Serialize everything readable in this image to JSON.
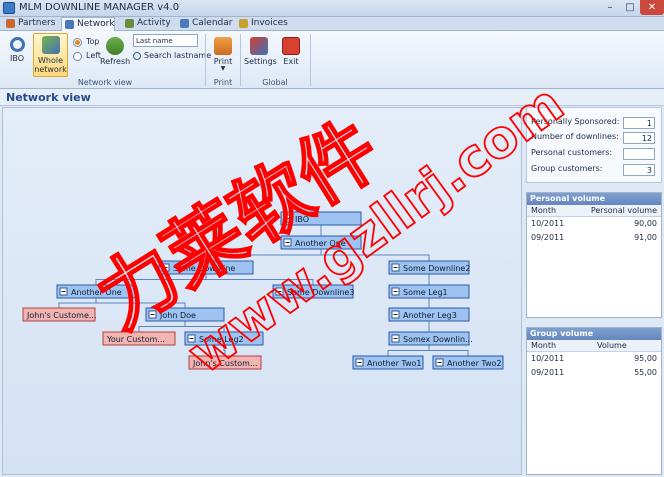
{
  "window": {
    "title": "MLM DOWNLINE MANAGER v4.0"
  },
  "tabs": [
    {
      "label": "Partners",
      "icon": "partners-icon",
      "color": "#c9672e",
      "active": false
    },
    {
      "label": "Network",
      "icon": "network-icon",
      "color": "#4a78b8",
      "active": true
    },
    {
      "label": "Activity",
      "icon": "activity-icon",
      "color": "#6a8f3a",
      "active": false
    },
    {
      "label": "Calendar",
      "icon": "calendar-icon",
      "color": "#4a78b8",
      "active": false
    },
    {
      "label": "Invoices",
      "icon": "invoices-icon",
      "color": "#c9a12e",
      "active": false
    }
  ],
  "ribbon": {
    "ibo_label": "IBO",
    "whole_network_label": "Whole\nnetwork",
    "top_label": "Top",
    "left_label": "Left",
    "refresh_label": "Refresh",
    "search_value": "Last name",
    "search_lastname_label": "Search lastname",
    "network_view_group": "Network view",
    "print_label": "Print",
    "print_group": "Print",
    "settings_label": "Settings",
    "exit_label": "Exit",
    "global_group": "Global"
  },
  "view": {
    "title": "Network view"
  },
  "tree": {
    "nodes": [
      {
        "id": "ibo",
        "label": "IBO",
        "type": "partner",
        "expanded": true
      },
      {
        "id": "another-one",
        "label": "Another One",
        "type": "partner",
        "expanded": true
      },
      {
        "id": "some-downline",
        "label": "Some Downline",
        "type": "partner",
        "expanded": true
      },
      {
        "id": "some-downline2",
        "label": "Some Downline2",
        "type": "partner",
        "expanded": true
      },
      {
        "id": "another-one-b",
        "label": "Another One",
        "type": "partner",
        "expanded": true
      },
      {
        "id": "some-downline3",
        "label": "Some Downline3",
        "type": "partner",
        "expanded": false
      },
      {
        "id": "some-leg1",
        "label": "Some Leg1",
        "type": "partner",
        "expanded": true
      },
      {
        "id": "johns-customer",
        "label": "John's Custome...",
        "type": "customer",
        "expanded": false
      },
      {
        "id": "john-doe",
        "label": "John Doe",
        "type": "partner",
        "expanded": true
      },
      {
        "id": "another-leg3",
        "label": "Another Leg3",
        "type": "partner",
        "expanded": true
      },
      {
        "id": "your-customer",
        "label": "Your Custom...",
        "type": "customer",
        "expanded": false
      },
      {
        "id": "some-leg2",
        "label": "Some Leg2",
        "type": "partner",
        "expanded": true
      },
      {
        "id": "somex-downline",
        "label": "Somex Downlin...",
        "type": "partner",
        "expanded": true
      },
      {
        "id": "johns-customer-2",
        "label": "John's Custom...",
        "type": "customer",
        "expanded": false
      },
      {
        "id": "another-two1",
        "label": "Another Two1",
        "type": "partner",
        "expanded": false
      },
      {
        "id": "another-two2",
        "label": "Another Two2",
        "type": "partner",
        "expanded": false
      }
    ]
  },
  "stats": {
    "personally_sponsored_label": "Personally Sponsored:",
    "personally_sponsored": "1",
    "downlines_label": "Number of downlines:",
    "downlines": "12",
    "personal_customers_label": "Personal customers:",
    "personal_customers": "",
    "group_customers_label": "Group customers:",
    "group_customers": "3"
  },
  "personal_volume": {
    "title": "Personal volume",
    "col_month": "Month",
    "col_value": "Personal volume",
    "rows": [
      {
        "month": "10/2011",
        "value": "90,00"
      },
      {
        "month": "09/2011",
        "value": "91,00"
      }
    ]
  },
  "group_volume": {
    "title": "Group volume",
    "col_month": "Month",
    "col_value": "Volume",
    "rows": [
      {
        "month": "10/2011",
        "value": "95,00"
      },
      {
        "month": "09/2011",
        "value": "55,00"
      }
    ]
  },
  "colors": {
    "partner_fill": "#9ec3f0",
    "partner_border": "#2a5aa8",
    "customer_fill": "#f2b4b0",
    "customer_border": "#b04040",
    "connector": "#5b84c4"
  },
  "watermark": {
    "text_cn": "力莱软件",
    "text_url": "www.gzllrj.com",
    "color": "#ff0000"
  }
}
